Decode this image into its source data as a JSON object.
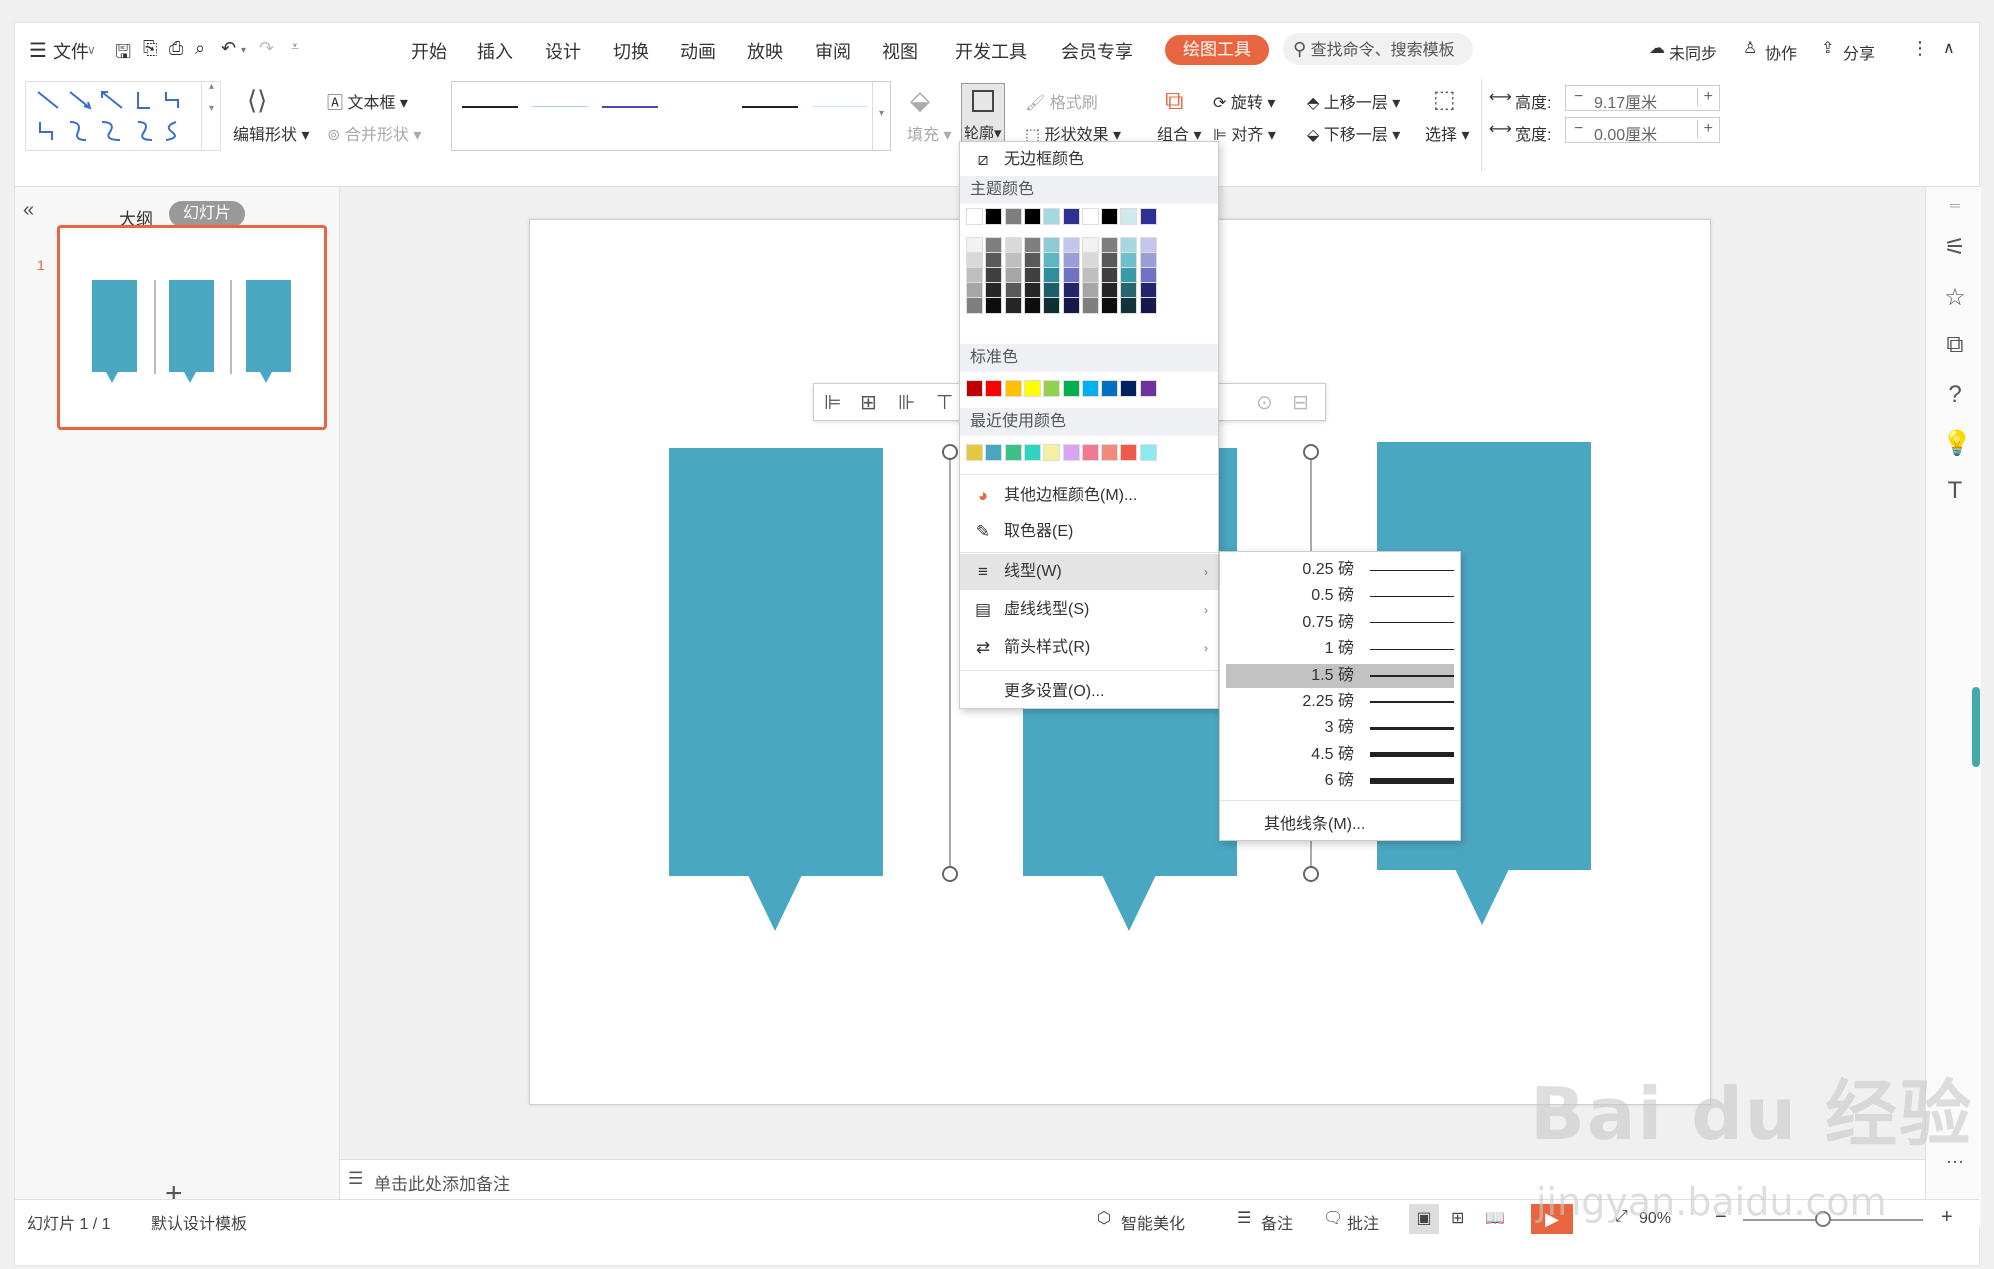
{
  "menubar": {
    "file": "文件",
    "tabs": [
      "开始",
      "插入",
      "设计",
      "切换",
      "动画",
      "放映",
      "审阅",
      "视图",
      "开发工具",
      "会员专享"
    ],
    "active_tab": "绘图工具",
    "search": "查找命令、搜索模板",
    "unsynced": "未同步",
    "collab": "协作",
    "share": "分享"
  },
  "ribbon": {
    "edit_shape": "编辑形状",
    "textbox": "文本框",
    "merge_shape": "合并形状",
    "fill": "填充",
    "outline": "轮廓",
    "format_painter": "格式刷",
    "shape_effects": "形状效果",
    "group": "组合",
    "rotate": "旋转",
    "align": "对齐",
    "bring_forward": "上移一层",
    "send_backward": "下移一层",
    "select": "选择",
    "height_label": "高度:",
    "height_value": "9.17厘米",
    "width_label": "宽度:",
    "width_value": "0.00厘米"
  },
  "left_panel": {
    "outline_tab": "大纲",
    "slides_tab": "幻灯片",
    "slide_number": "1"
  },
  "notes": {
    "placeholder": "单击此处添加备注"
  },
  "statusbar": {
    "slide_info": "幻灯片 1 / 1",
    "template": "默认设计模板",
    "beautify": "智能美化",
    "notes": "备注",
    "comments": "批注",
    "zoom": "90%"
  },
  "outline_menu": {
    "no_border": "无边框颜色",
    "theme_colors": "主题颜色",
    "standard_colors": "标准色",
    "recent_colors": "最近使用颜色",
    "more_colors": "其他边框颜色(M)...",
    "eyedropper": "取色器(E)",
    "line_type": "线型(W)",
    "dash_type": "虚线线型(S)",
    "arrow_style": "箭头样式(R)",
    "more_settings": "更多设置(O)...",
    "theme_top_row": [
      "#ffffff",
      "#000000",
      "#7f7f7f",
      "#000000",
      "#a7d7df",
      "#2e3192",
      "#ffffff",
      "#000000",
      "#cde9ee",
      "#2e3192"
    ],
    "standard": [
      "#c00000",
      "#ff0000",
      "#ffc000",
      "#ffff00",
      "#92d050",
      "#00b050",
      "#00b0f0",
      "#0070c0",
      "#002060",
      "#7030a0"
    ],
    "recent": [
      "#e6c740",
      "#4aa7c2",
      "#3cc08a",
      "#2dd4c0",
      "#f5f0a0",
      "#d9a5f0",
      "#f07890",
      "#f08a7a",
      "#f05a4a",
      "#8ee8f0"
    ]
  },
  "line_weights": {
    "items": [
      {
        "label": "0.25 磅",
        "weight": 0.25
      },
      {
        "label": "0.5 磅",
        "weight": 0.5
      },
      {
        "label": "0.75 磅",
        "weight": 0.75
      },
      {
        "label": "1 磅",
        "weight": 1
      },
      {
        "label": "1.5 磅",
        "weight": 1.5
      },
      {
        "label": "2.25 磅",
        "weight": 2.25
      },
      {
        "label": "3 磅",
        "weight": 3
      },
      {
        "label": "4.5 磅",
        "weight": 4.5
      },
      {
        "label": "6 磅",
        "weight": 6
      }
    ],
    "selected": "1.5 磅",
    "more_lines": "其他线条(M)..."
  },
  "watermark": {
    "brand": "Bai du 经验",
    "url": "jingyan.baidu.com"
  },
  "colors": {
    "shape": "#4aa7c2",
    "accent": "#e8663f"
  }
}
